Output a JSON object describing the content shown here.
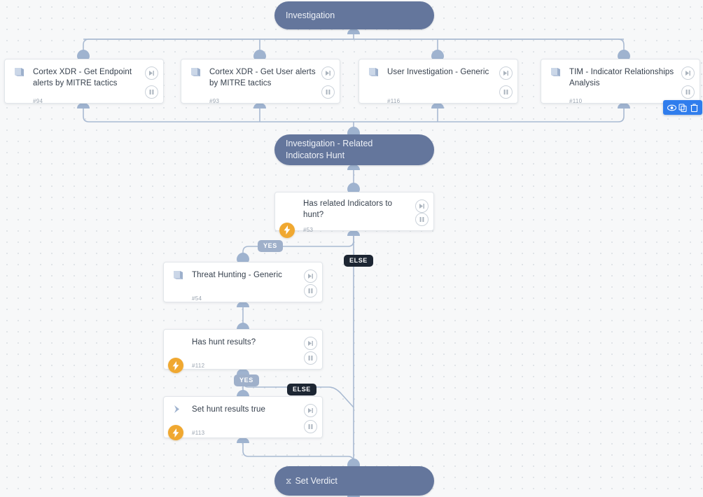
{
  "canvas": {
    "background_color": "#f7f8f9",
    "grid_dot_color": "#d9dde2"
  },
  "colors": {
    "section_pill": "#64769c",
    "card_background": "#ffffff",
    "card_border": "#e2e6ea",
    "edge_line": "#a9bad2",
    "yes_label": "#9fb0ca",
    "else_label": "#1d2633",
    "bolt_badge": "#f0a830",
    "toolbar_blue": "#2f7ded",
    "title_text": "#36404d",
    "id_text": "#9aa4b0"
  },
  "sections": [
    {
      "id": "investigation",
      "label": "Investigation"
    },
    {
      "id": "related-indicators-hunt",
      "label": "Investigation - Related\nIndicators Hunt",
      "line1": "Investigation - Related",
      "line2": "Indicators Hunt"
    },
    {
      "id": "set-verdict",
      "label": "Set Verdict",
      "icon": "hourglass-icon",
      "glyph": "⧖"
    }
  ],
  "tasks": [
    {
      "id": "task-94",
      "title": "Cortex XDR - Get Endpoint alerts by MITRE tactics",
      "task_id": "#94",
      "icon": "playbook-icon",
      "has_bolt": false,
      "controls": [
        "skip-to-next-icon",
        "pause-icon"
      ]
    },
    {
      "id": "task-93",
      "title": "Cortex XDR - Get User alerts by MITRE tactics",
      "task_id": "#93",
      "icon": "playbook-icon",
      "has_bolt": false,
      "controls": [
        "skip-to-next-icon",
        "pause-icon"
      ]
    },
    {
      "id": "task-116",
      "title": "User Investigation - Generic",
      "task_id": "#116",
      "icon": "playbook-icon",
      "has_bolt": false,
      "controls": [
        "skip-to-next-icon",
        "pause-icon"
      ]
    },
    {
      "id": "task-110",
      "title": "TIM - Indicator Relationships Analysis",
      "task_id": "#110",
      "icon": "playbook-icon",
      "has_bolt": false,
      "controls": [
        "skip-to-next-icon",
        "pause-icon"
      ]
    },
    {
      "id": "task-53",
      "title": "Has related Indicators to hunt?",
      "task_id": "#53",
      "icon": "condition-diamond-icon",
      "has_bolt": true,
      "controls": [
        "skip-to-next-icon",
        "pause-icon"
      ]
    },
    {
      "id": "task-54",
      "title": "Threat Hunting - Generic",
      "task_id": "#54",
      "icon": "playbook-icon",
      "has_bolt": false,
      "controls": [
        "skip-to-next-icon",
        "pause-icon"
      ]
    },
    {
      "id": "task-112",
      "title": "Has hunt results?",
      "task_id": "#112",
      "icon": "condition-diamond-icon",
      "has_bolt": true,
      "controls": [
        "skip-to-next-icon",
        "pause-icon"
      ]
    },
    {
      "id": "task-113",
      "title": "Set hunt results true",
      "task_id": "#113",
      "icon": "automation-arrow-icon",
      "has_bolt": true,
      "controls": [
        "skip-to-next-icon",
        "pause-icon"
      ]
    }
  ],
  "edge_labels": {
    "yes_1": "YES",
    "else_1": "ELSE",
    "yes_2": "YES",
    "else_2": "ELSE"
  },
  "hover_toolbar": {
    "attached_to": "#110",
    "buttons": [
      {
        "name": "view-icon",
        "label": "View"
      },
      {
        "name": "copy-icon",
        "label": "Copy"
      },
      {
        "name": "delete-icon",
        "label": "Delete"
      }
    ]
  }
}
